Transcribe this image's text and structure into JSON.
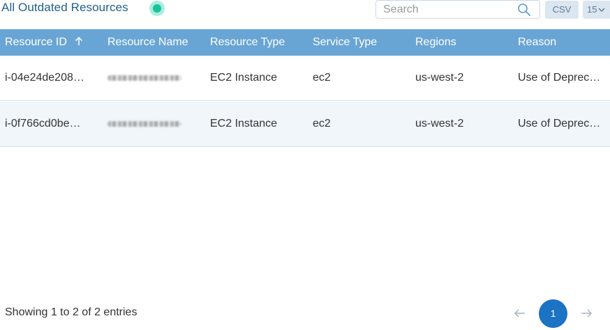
{
  "header": {
    "title": "All Outdated Resources",
    "search_placeholder": "Search",
    "csv_label": "CSV",
    "page_size": "15"
  },
  "table": {
    "columns": [
      "Resource ID",
      "Resource Name",
      "Resource Type",
      "Service Type",
      "Regions",
      "Reason"
    ],
    "sorted_column": "Resource ID",
    "sort_direction": "ascending",
    "rows": [
      {
        "resource_id": "i-04e24de208…",
        "resource_type": "EC2 Instance",
        "service_type": "ec2",
        "region": "us-west-2",
        "reason": "Use of Deprec…"
      },
      {
        "resource_id": "i-0f766cd0be…",
        "resource_type": "EC2 Instance",
        "service_type": "ec2",
        "region": "us-west-2",
        "reason": "Use of Deprec…"
      }
    ]
  },
  "footer": {
    "entries_text": "Showing 1 to 2 of 2 entries",
    "current_page": "1"
  },
  "colors": {
    "header_bg": "#69a5d4",
    "accent": "#1b73c4",
    "title": "#1f5f8b",
    "status_dot": "#19c39a",
    "row_alt": "#f1f6fb"
  },
  "icons": [
    "status-dot",
    "search-icon",
    "sort-up-icon",
    "chevron-down-icon",
    "arrow-left-icon",
    "arrow-right-icon"
  ]
}
